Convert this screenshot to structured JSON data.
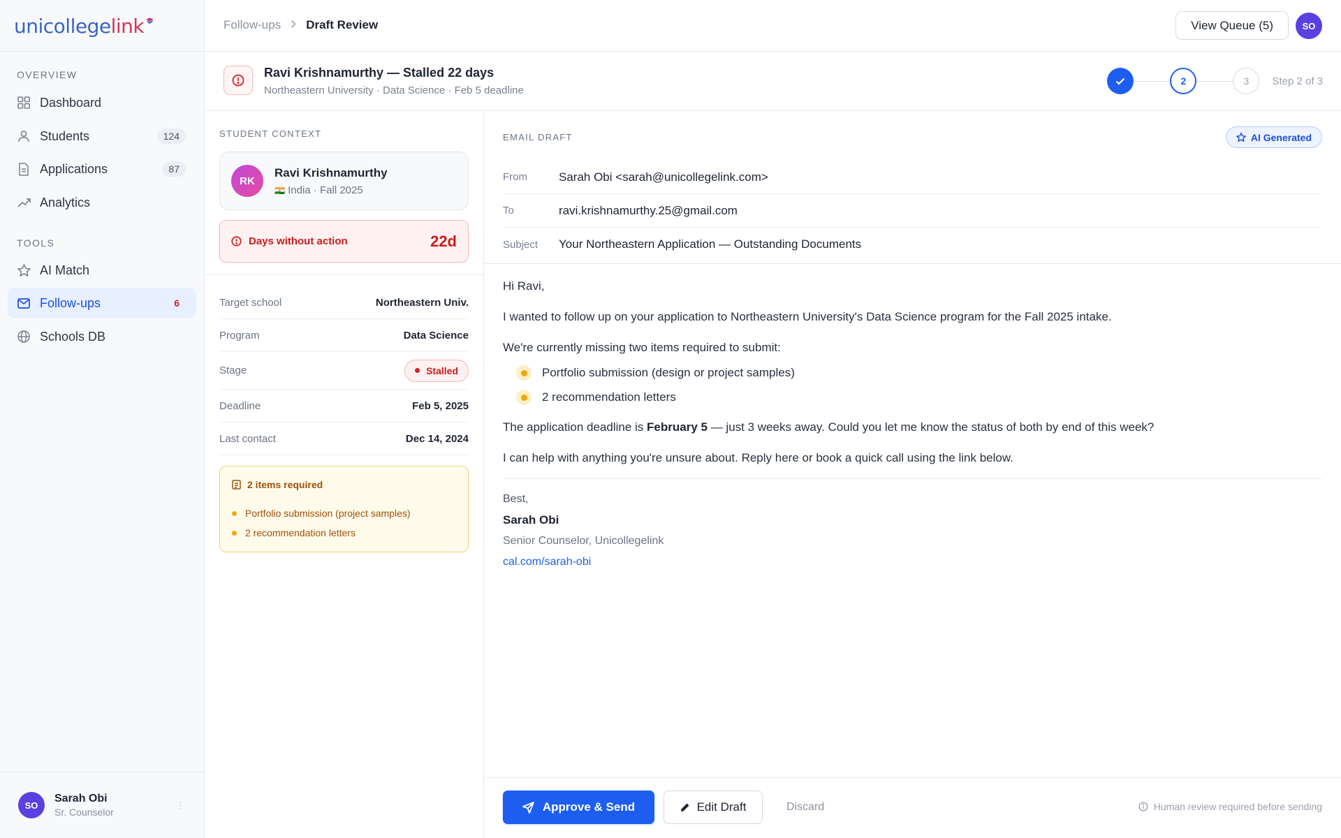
{
  "brand": {
    "logo_main": "unicollege",
    "logo_accent": "link",
    "colors": {
      "primary": "#1d5ef0",
      "danger": "#d72027",
      "warning": "#f0a70f",
      "brand_pink": "#d8325a"
    }
  },
  "sidebar": {
    "overview_label": "OVERVIEW",
    "tools_label": "TOOLS",
    "overview_items": [
      {
        "label": "Dashboard",
        "icon": "grid-icon",
        "count": ""
      },
      {
        "label": "Students",
        "icon": "user-icon",
        "count": "124"
      },
      {
        "label": "Applications",
        "icon": "document-icon",
        "count": "87"
      },
      {
        "label": "Analytics",
        "icon": "trend-icon",
        "count": ""
      }
    ],
    "tools_items": [
      {
        "label": "AI Match",
        "icon": "star-icon",
        "count": ""
      },
      {
        "label": "Follow-ups",
        "icon": "mail-icon",
        "count": "6",
        "active": true
      },
      {
        "label": "Schools DB",
        "icon": "globe-icon",
        "count": ""
      }
    ],
    "user": {
      "initials": "SO",
      "name": "Sarah Obi",
      "role": "Sr. Counselor"
    }
  },
  "topbar": {
    "breadcrumb_parent": "Follow-ups",
    "breadcrumb_current": "Draft Review",
    "queue_button": "View Queue (5)",
    "avatar_initials": "SO"
  },
  "header": {
    "title": "Ravi Krishnamurthy — Stalled 22 days",
    "subtitle": "Northeastern University · Data Science · Feb 5 deadline",
    "steps": [
      "1",
      "2",
      "3"
    ],
    "current_step": 2,
    "step_label": "Step 2 of 3"
  },
  "context": {
    "section_label": "STUDENT CONTEXT",
    "student": {
      "initials": "RK",
      "name": "Ravi Krishnamurthy",
      "flag": "🇮🇳",
      "meta": "India · Fall 2025"
    },
    "days_label": "Days without action",
    "days_value": "22d",
    "details": [
      {
        "key": "Target school",
        "value": "Northeastern Univ."
      },
      {
        "key": "Program",
        "value": "Data Science"
      },
      {
        "key": "Stage",
        "value": "Stalled"
      },
      {
        "key": "Deadline",
        "value": "Feb 5, 2025"
      },
      {
        "key": "Last contact",
        "value": "Dec 14, 2024"
      }
    ],
    "requirements": {
      "title": "2 items required",
      "items": [
        "Portfolio submission (project samples)",
        "2 recommendation letters"
      ]
    }
  },
  "email": {
    "section_label": "EMAIL DRAFT",
    "ai_badge": "AI Generated",
    "from_label": "From",
    "from_value": "Sarah Obi <sarah@unicollegelink.com>",
    "to_label": "To",
    "to_value": "ravi.krishnamurthy.25@gmail.com",
    "subject_label": "Subject",
    "subject_value": "Your Northeastern Application — Outstanding Documents",
    "greeting": "Hi Ravi,",
    "para1": "I wanted to follow up on your application to Northeastern University's Data Science program for the Fall 2025 intake.",
    "para2": "We're currently missing two items required to submit:",
    "bullets": [
      "Portfolio submission (design or project samples)",
      "2 recommendation letters"
    ],
    "para3_before": "The application deadline is ",
    "para3_bold": "February 5",
    "para3_after": " — just 3 weeks away. Could you let me know the status of both by end of this week?",
    "para4": "I can help with anything you're unsure about. Reply here or book a quick call using the link below.",
    "sign_off": "Best,",
    "sign_name": "Sarah Obi",
    "sign_role": "Senior Counselor, Unicollegelink",
    "sign_link": "cal.com/sarah-obi"
  },
  "actions": {
    "approve": "Approve & Send",
    "edit": "Edit Draft",
    "discard": "Discard",
    "note": "Human review required before sending"
  }
}
